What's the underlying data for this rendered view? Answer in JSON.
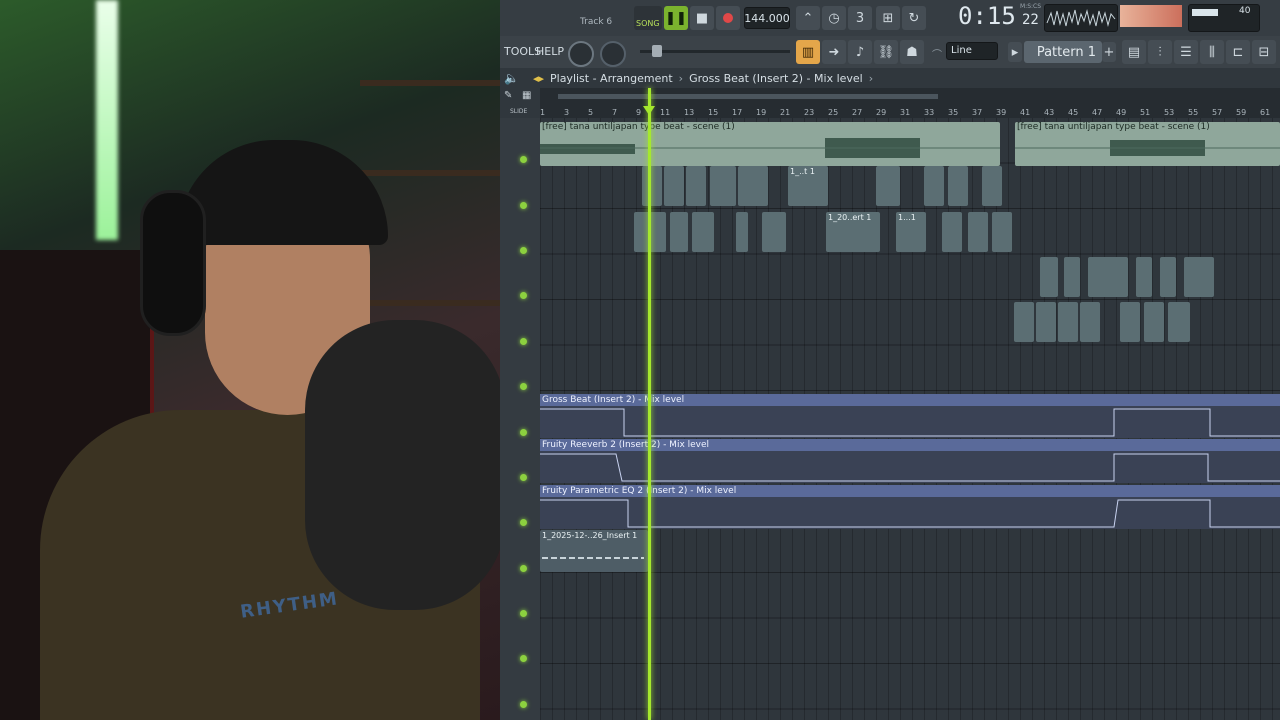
{
  "toolbar": {
    "track_label": "Track 6",
    "song_label": "SONG",
    "tempo": "144.000",
    "time": "0:15",
    "time_sub": "22",
    "time_unit": "M:S:CS",
    "cpu_value": "40",
    "menu_tools": "TOOLS",
    "menu_help": "HELP",
    "snap_mode": "Line",
    "pattern_name": "Pattern 1"
  },
  "playlist": {
    "title": "Playlist - Arrangement",
    "breadcrumb": "Gross Beat (Insert 2) - Mix level",
    "slide_label": "SLIDE",
    "ruler_ticks": [
      "1",
      "3",
      "5",
      "7",
      "9",
      "11",
      "13",
      "15",
      "17",
      "19",
      "21",
      "23",
      "25",
      "27",
      "29",
      "31",
      "33",
      "35",
      "37",
      "39",
      "41",
      "43",
      "45",
      "47",
      "49",
      "51",
      "53",
      "55",
      "57",
      "59",
      "61"
    ]
  },
  "clips": {
    "scene_a": "[free] tana  untiljapan type beat - scene (1)",
    "scene_b": "[free] tana  untiljapan type beat - scene (1)",
    "clip_t1": "1_..t 1",
    "clip_ert1": "1_20..ert 1",
    "clip_t1b": "1...1",
    "clip_insert1": "1_2025-12-..26_Insert 1"
  },
  "automation": {
    "gross_beat": "Gross Beat (Insert 2) - Mix level",
    "reeverb": "Fruity Reeverb 2 (Insert 2) - Mix level",
    "param_eq": "Fruity Parametric EQ 2 (Insert 2) - Mix level"
  },
  "webcam": {
    "shirt_text": "RHYTHM"
  }
}
